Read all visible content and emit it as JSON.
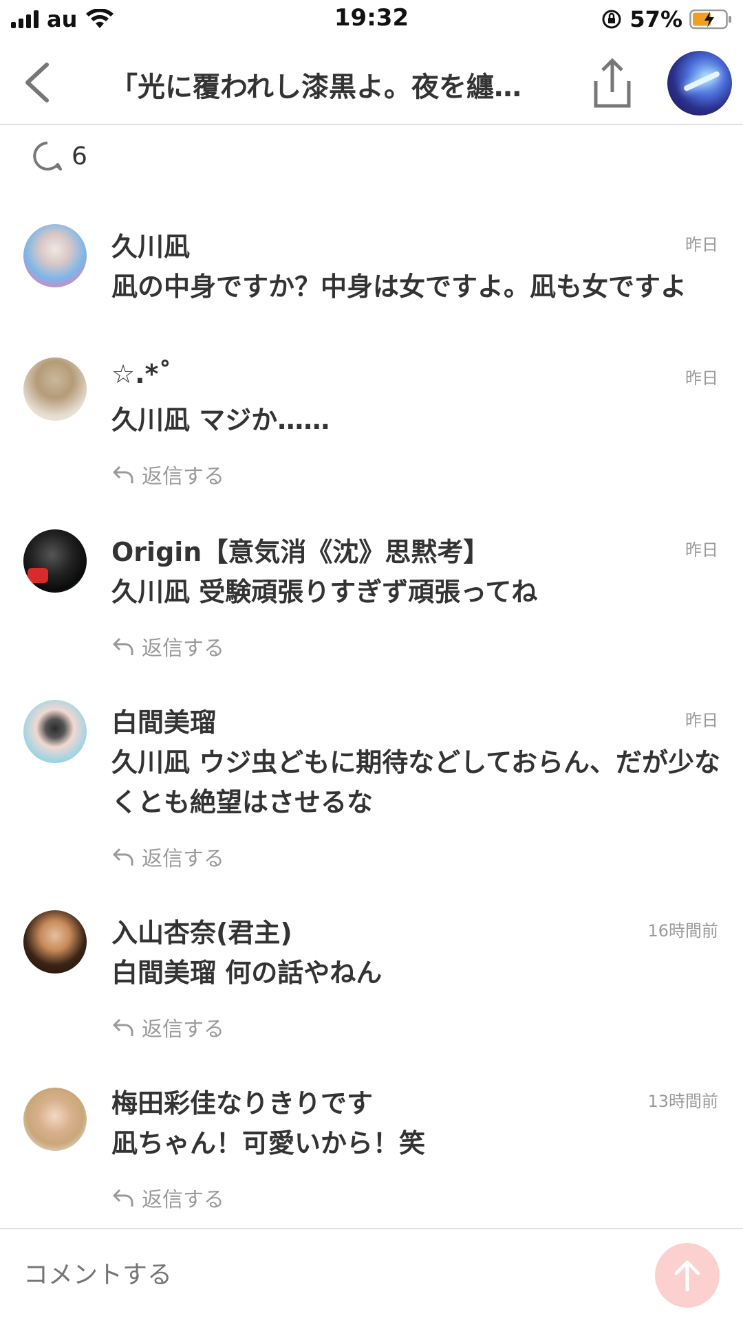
{
  "status_bar": {
    "carrier": "au",
    "time": "19:32",
    "battery_percent": "57%",
    "battery_level": 0.57,
    "icons": [
      "signal-icon",
      "wifi-icon",
      "rotation-lock-icon",
      "battery-charging-icon"
    ]
  },
  "header": {
    "title": "「光に覆われし漆黒よ。夜を纏…",
    "icons": [
      "back-chevron-icon",
      "share-icon"
    ],
    "avatar_colors": [
      "#9fd8ff",
      "#4a6bd8",
      "#1a1450"
    ]
  },
  "comment_count": {
    "value": "6",
    "icon": "comment-bubble-icon"
  },
  "comments": [
    {
      "name": "久川凪",
      "time": "昨日",
      "body": "凪の中身ですか？中身は女ですよ。凪も女ですよ",
      "reply_label": ""
    },
    {
      "name": "☆.*˚",
      "time": "昨日",
      "body": "久川凪 マジか……",
      "reply_label": "返信する"
    },
    {
      "name": "Origin【意気消《沈》思黙考】",
      "time": "昨日",
      "body": "久川凪 受験頑張りすぎず頑張ってね",
      "reply_label": "返信する"
    },
    {
      "name": "白間美瑠",
      "time": "昨日",
      "body": "久川凪 ウジ虫どもに期待などしておらん、だが少なくとも絶望はさせるな",
      "reply_label": "返信する"
    },
    {
      "name": "入山杏奈(君主)",
      "time": "16時間前",
      "body": "白間美瑠 何の話やねん",
      "reply_label": "返信する"
    },
    {
      "name": "梅田彩佳なりきりです",
      "time": "13時間前",
      "body": "凪ちゃん！可愛いから！笑",
      "reply_label": "返信する"
    }
  ],
  "composer": {
    "placeholder": "コメントする",
    "send_icon": "arrow-up-icon",
    "send_color": "#fbd0cf"
  },
  "colors": {
    "text": "#333333",
    "muted": "#9a9a9a",
    "divider": "#e0e0e0"
  }
}
